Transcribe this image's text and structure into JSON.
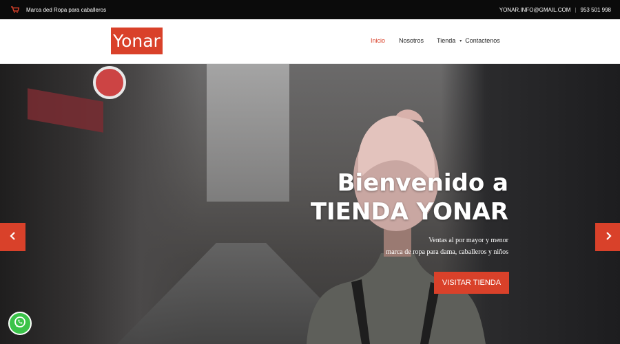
{
  "topbar": {
    "tagline": "Marca ded Ropa para caballeros",
    "email": "YONAR.INFO@GMAIL.COM",
    "separator": "|",
    "phone": "953 501 998",
    "icon": "cart-icon"
  },
  "navbar": {
    "logo_text": "Yonar",
    "menu": [
      {
        "label": "Inicio",
        "active": true
      },
      {
        "label": "Nosotros"
      },
      {
        "label": "Tienda",
        "has_dropdown": true
      },
      {
        "label": "Contactenos"
      }
    ]
  },
  "hero": {
    "title_line1": "Bienvenido a",
    "title_line2": "TIENDA YONAR",
    "subtitle_line1": "Ventas al por mayor y menor",
    "subtitle_line2": "marca de ropa para dama, caballeros y niños",
    "cta_label": "VISITAR TIENDA",
    "prev_icon": "chevron-left-icon",
    "next_icon": "chevron-right-icon"
  },
  "floating": {
    "whatsapp_icon": "whatsapp-icon"
  },
  "colors": {
    "accent": "#d9412a",
    "topbar_bg": "#0b0b0b",
    "whatsapp": "#3bc34a"
  }
}
